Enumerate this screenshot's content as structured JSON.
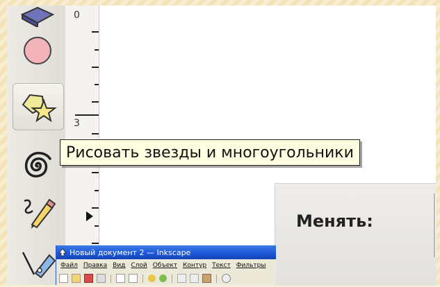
{
  "toolbox": {
    "tools": [
      {
        "name": "3d-box-tool",
        "icon": "3d-box-icon",
        "active": false
      },
      {
        "name": "ellipse-tool",
        "icon": "ellipse-icon",
        "active": false
      },
      {
        "name": "star-polygon-tool",
        "icon": "star-polygon-icon",
        "active": true
      },
      {
        "name": "spiral-tool",
        "icon": "spiral-icon",
        "active": false
      },
      {
        "name": "pencil-tool",
        "icon": "pencil-icon",
        "active": false
      },
      {
        "name": "pen-tool",
        "icon": "pen-icon",
        "active": false
      }
    ]
  },
  "ruler": {
    "labels": [
      "0",
      "3"
    ]
  },
  "tooltip": {
    "text": "Рисовать звезды и многоугольники"
  },
  "zoom_panel": {
    "label": "Менять:"
  },
  "mini_window": {
    "title": "Новый документ 2 — Inkscape",
    "menu": [
      "Файл",
      "Правка",
      "Вид",
      "Слой",
      "Объект",
      "Контур",
      "Текст",
      "Фильтры"
    ]
  },
  "colors": {
    "tooltip_bg": "#ffffe1",
    "titlebar": "#1d56d6",
    "ellipse_fill": "#f2b3bb",
    "star_fill": "#f7e98a"
  }
}
